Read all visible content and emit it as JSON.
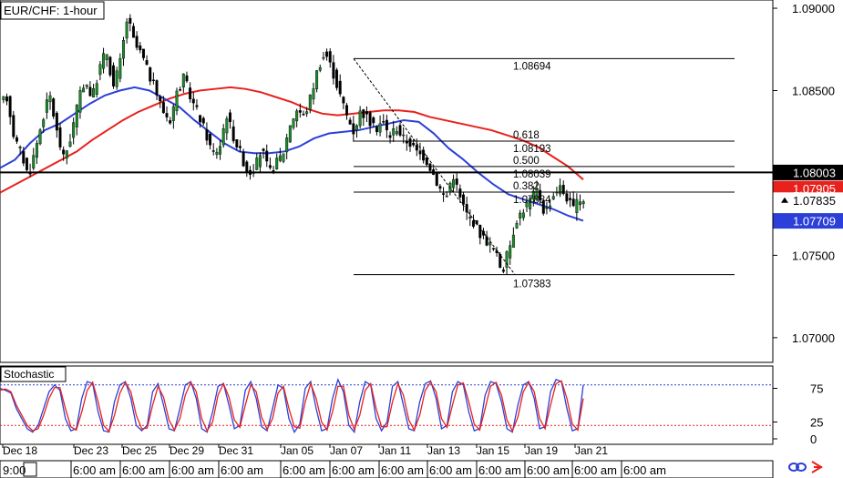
{
  "chart_data": [
    {
      "type": "candlestick",
      "title": "EUR/CHF: 1-hour",
      "y_axis_ticks": [
        "1.09000",
        "1.08500",
        "1.07500",
        "1.07000"
      ],
      "ylim": [
        1.0685,
        1.0905
      ],
      "x_date_labels": [
        "Dec 18",
        "Dec 23",
        "Dec 25",
        "Dec 29",
        "Dec 31",
        "Jan 05",
        "Jan 07",
        "Jan 11",
        "Jan 13",
        "Jan 15",
        "Jan 19",
        "Jan 21"
      ],
      "x_time_labels": [
        "9:00",
        "6:00 am",
        "6:00 am",
        "6:00 am",
        "6:00 am",
        "6:00 am",
        "6:00 am",
        "6:00 am",
        "6:00 am",
        "6:00 am",
        "6:00 am",
        "6:00 am",
        "6:00 am"
      ],
      "price_path": [
        1.0842,
        1.0846,
        1.0821,
        1.0812,
        1.0798,
        1.0815,
        1.0833,
        1.0848,
        1.0825,
        1.0808,
        1.0822,
        1.0843,
        1.0857,
        1.0845,
        1.0863,
        1.0875,
        1.0852,
        1.0868,
        1.0895,
        1.0878,
        1.0872,
        1.086,
        1.085,
        1.0838,
        1.0832,
        1.0849,
        1.0858,
        1.0845,
        1.0836,
        1.0825,
        1.0812,
        1.0815,
        1.0836,
        1.0822,
        1.0812,
        1.08,
        1.0803,
        1.0815,
        1.08,
        1.0806,
        1.0812,
        1.083,
        1.0839,
        1.0834,
        1.0848,
        1.0865,
        1.0873,
        1.0862,
        1.0848,
        1.0835,
        1.0825,
        1.0838,
        1.0833,
        1.0826,
        1.0832,
        1.0822,
        1.0828,
        1.0821,
        1.0818,
        1.0812,
        1.081,
        1.0802,
        1.0792,
        1.0784,
        1.08,
        1.0785,
        1.0775,
        1.077,
        1.0762,
        1.0758,
        1.0752,
        1.074,
        1.0755,
        1.0772,
        1.0778,
        1.0784,
        1.079,
        1.0775,
        1.0785,
        1.0792,
        1.0786,
        1.0778,
        1.0784
      ],
      "moving_averages": [
        {
          "color": "#e8211c",
          "values": [
            1.0788,
            1.0793,
            1.0798,
            1.0803,
            1.0808,
            1.0813,
            1.082,
            1.0826,
            1.0832,
            1.0837,
            1.0841,
            1.0845,
            1.0848,
            1.085,
            1.0851,
            1.0852,
            1.0851,
            1.0849,
            1.0846,
            1.0843,
            1.0839,
            1.0836,
            1.0835,
            1.0836,
            1.0837,
            1.0838,
            1.0838,
            1.0837,
            1.0834,
            1.0832,
            1.083,
            1.0828,
            1.0826,
            1.0823,
            1.082,
            1.0816,
            1.081,
            1.0804,
            1.0796
          ]
        },
        {
          "color": "#2c3fd8",
          "values": [
            1.0803,
            1.0808,
            1.0818,
            1.0826,
            1.083,
            1.0836,
            1.0842,
            1.0847,
            1.085,
            1.0852,
            1.085,
            1.0845,
            1.084,
            1.0832,
            1.0825,
            1.0818,
            1.0813,
            1.0812,
            1.0812,
            1.0813,
            1.0816,
            1.0821,
            1.0824,
            1.0825,
            1.0826,
            1.0828,
            1.083,
            1.0832,
            1.0831,
            1.0824,
            1.0815,
            1.0808,
            1.08,
            1.0793,
            1.0787,
            1.0784,
            1.0781,
            1.0778,
            1.0774,
            1.0771
          ]
        }
      ],
      "horizontal_line": {
        "value": 1.08003,
        "color": "#000000"
      },
      "fibonacci": {
        "high": "1.08694",
        "low": "1.07383",
        "levels": [
          {
            "ratio": "0.618",
            "price": "1.08193"
          },
          {
            "ratio": "0.500",
            "price": "1.08039"
          },
          {
            "ratio": "0.382",
            "price": "1.07884"
          }
        ]
      },
      "price_labels": [
        {
          "text": "1.08003",
          "bg": "#000000",
          "fg": "#ffffff"
        },
        {
          "text": "1.07905",
          "bg": "#e8211c",
          "fg": "#ffffff"
        },
        {
          "text": "1.07835",
          "bg": "#ffffff",
          "fg": "#000000"
        },
        {
          "text": "1.07709",
          "bg": "#2c3fd8",
          "fg": "#ffffff"
        }
      ]
    },
    {
      "type": "line",
      "title": "Stochastic",
      "y_axis_ticks": [
        "75",
        "25",
        "0"
      ],
      "ylim": [
        0,
        100
      ],
      "levels": [
        80,
        20
      ],
      "series": [
        {
          "color": "#2c3fd8",
          "values": [
            75,
            72,
            68,
            45,
            30,
            15,
            10,
            20,
            45,
            70,
            80,
            72,
            30,
            12,
            15,
            60,
            85,
            82,
            40,
            12,
            10,
            55,
            80,
            85,
            60,
            20,
            12,
            20,
            70,
            82,
            50,
            15,
            12,
            45,
            80,
            85,
            60,
            15,
            10,
            40,
            78,
            82,
            50,
            15,
            20,
            72,
            85,
            60,
            18,
            12,
            45,
            80,
            75,
            30,
            10,
            22,
            75,
            85,
            45,
            12,
            15,
            60,
            88,
            70,
            20,
            10,
            55,
            85,
            80,
            30,
            12,
            25,
            78,
            85,
            50,
            15,
            12,
            55,
            82,
            86,
            60,
            15,
            20,
            70,
            85,
            80,
            40,
            12,
            15,
            65,
            85,
            82,
            55,
            15,
            10,
            50,
            80,
            85,
            60,
            15,
            18,
            70,
            88,
            85,
            45,
            12,
            15,
            80
          ]
        },
        {
          "color": "#e8211c",
          "values": [
            72,
            74,
            70,
            50,
            35,
            20,
            12,
            15,
            35,
            60,
            76,
            76,
            45,
            18,
            13,
            40,
            72,
            84,
            55,
            20,
            11,
            35,
            68,
            84,
            70,
            35,
            15,
            16,
            50,
            78,
            62,
            28,
            13,
            30,
            65,
            84,
            70,
            30,
            12,
            25,
            65,
            82,
            62,
            28,
            17,
            50,
            80,
            70,
            32,
            14,
            30,
            68,
            78,
            45,
            18,
            16,
            55,
            82,
            60,
            25,
            13,
            40,
            78,
            78,
            35,
            14,
            35,
            72,
            82,
            45,
            18,
            18,
            55,
            82,
            65,
            28,
            13,
            35,
            72,
            84,
            70,
            30,
            17,
            50,
            80,
            83,
            55,
            22,
            13,
            45,
            78,
            84,
            65,
            28,
            12,
            32,
            70,
            84,
            70,
            30,
            15,
            50,
            82,
            86,
            60,
            22,
            13,
            60
          ]
        }
      ]
    }
  ]
}
